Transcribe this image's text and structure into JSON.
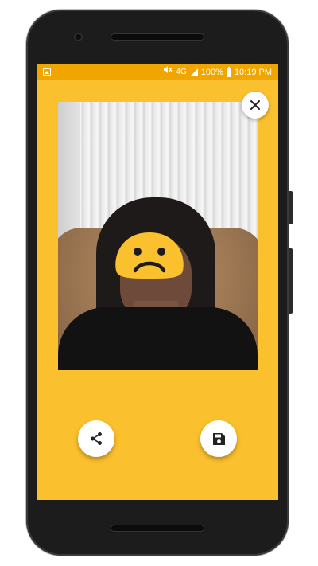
{
  "status_bar": {
    "network": "4G",
    "battery_percent": "100%",
    "time": "10:19 PM",
    "icons": [
      "image-notification-icon",
      "mute-vibrate-icon",
      "lte-icon",
      "signal-icon",
      "battery-icon"
    ]
  },
  "photo": {
    "overlay": "sad-face-emoji"
  },
  "actions": {
    "close_icon": "close-icon",
    "share_icon": "share-icon",
    "save_icon": "save-icon"
  },
  "colors": {
    "screen_background": "#FBC02D",
    "status_bar_background": "#F0A500",
    "button_background": "#FFFFFF",
    "emoji_fill": "#FBC02D"
  }
}
